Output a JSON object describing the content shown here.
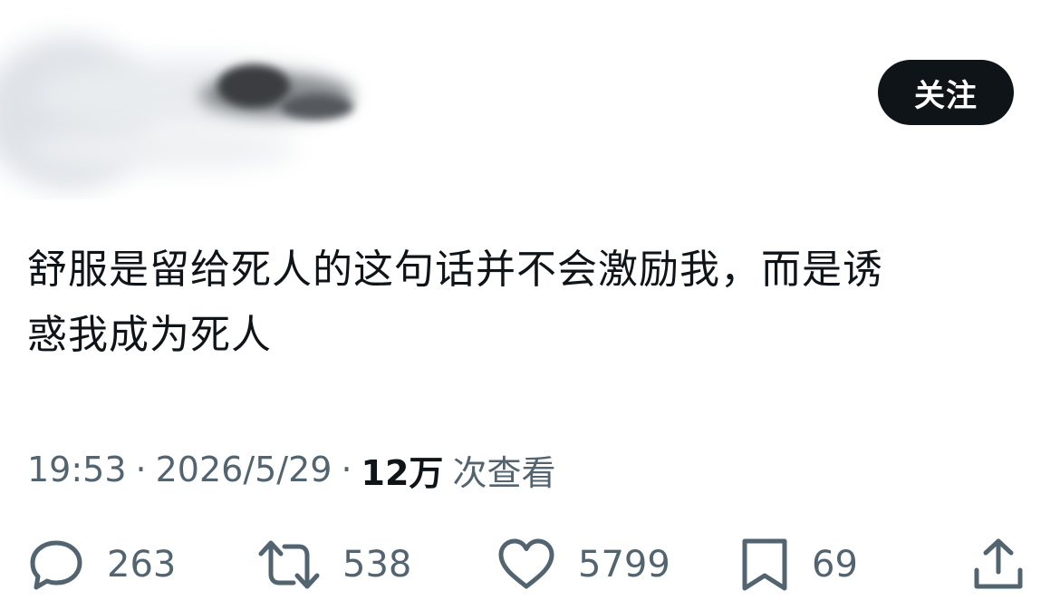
{
  "header": {
    "follow_label": "关注"
  },
  "tweet": {
    "line1": "舒服是留给死人的这句话并不会激励我，而是诱",
    "line2": "惑我成为死人"
  },
  "meta": {
    "time": "19:53",
    "date": "2026/5/29",
    "separator": "·",
    "views_count": "12万",
    "views_label": "次查看"
  },
  "actions": {
    "replies": "263",
    "retweets": "538",
    "likes": "5799",
    "bookmarks": "69"
  },
  "icons": {
    "reply": "reply-icon",
    "retweet": "retweet-icon",
    "like": "heart-icon",
    "bookmark": "bookmark-icon",
    "share": "share-icon"
  },
  "colors": {
    "text_primary": "#0f1419",
    "text_secondary": "#536471",
    "button_bg": "#0f1419",
    "button_text": "#ffffff"
  }
}
